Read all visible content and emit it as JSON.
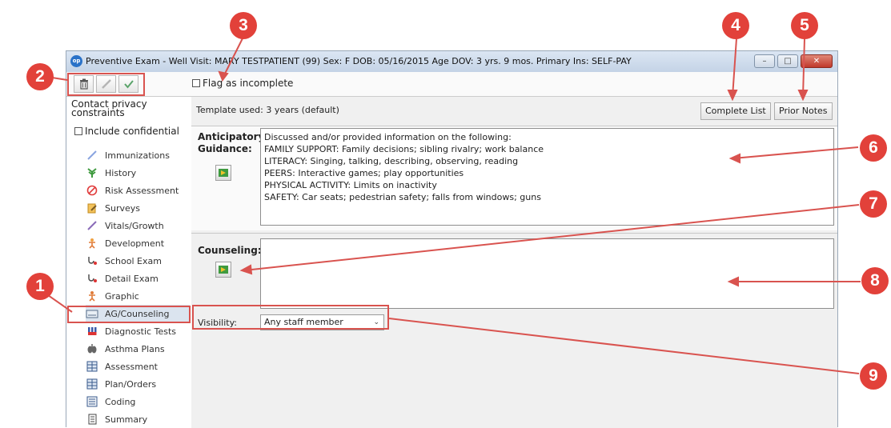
{
  "window": {
    "title": "Preventive Exam - Well Visit: MARY TESTPATIENT (99) Sex: F DOB: 05/16/2015 Age DOV: 3 yrs. 9 mos. Primary Ins: SELF-PAY",
    "icon_text": "op",
    "controls": [
      "minimize-icon",
      "maximize-icon",
      "close-icon"
    ]
  },
  "toolbar": {
    "buttons": [
      "trash-icon",
      "pencil-icon",
      "check-icon"
    ],
    "flag_label": "Flag as incomplete"
  },
  "sidebar": {
    "privacy_text": "Contact privacy constraints",
    "include_confidential": "Include confidential",
    "items": [
      {
        "label": "Immunizations",
        "icon": "syringe-icon"
      },
      {
        "label": "History",
        "icon": "tree-icon"
      },
      {
        "label": "Risk Assessment",
        "icon": "no-sign-icon"
      },
      {
        "label": "Surveys",
        "icon": "survey-icon"
      },
      {
        "label": "Vitals/Growth",
        "icon": "pen-icon"
      },
      {
        "label": "Development",
        "icon": "development-icon"
      },
      {
        "label": "School Exam",
        "icon": "stethoscope-icon"
      },
      {
        "label": "Detail Exam",
        "icon": "stethoscope-icon"
      },
      {
        "label": "Graphic",
        "icon": "figure-icon"
      },
      {
        "label": "AG/Counseling",
        "icon": "keyboard-icon"
      },
      {
        "label": "Diagnostic Tests",
        "icon": "test-tubes-icon"
      },
      {
        "label": "Asthma Plans",
        "icon": "lungs-icon"
      },
      {
        "label": "Assessment",
        "icon": "grid-icon"
      },
      {
        "label": "Plan/Orders",
        "icon": "grid-icon"
      },
      {
        "label": "Coding",
        "icon": "list-icon"
      },
      {
        "label": "Summary",
        "icon": "document-icon"
      }
    ]
  },
  "template": {
    "text": "Template used:  3 years (default)",
    "complete_list": "Complete List",
    "prior_notes": "Prior Notes"
  },
  "anticipatory": {
    "label_line1": "Anticipatory",
    "label_line2": "Guidance:",
    "lines": [
      "Discussed and/or provided information on the following:",
      "FAMILY SUPPORT: Family decisions; sibling rivalry; work balance",
      "LITERACY: Singing, talking, describing, observing, reading",
      "PEERS: Interactive games; play opportunities",
      "PHYSICAL ACTIVITY: Limits on inactivity",
      "SAFETY: Car seats; pedestrian safety; falls from windows; guns"
    ]
  },
  "counseling": {
    "label": "Counseling:",
    "value": ""
  },
  "visibility": {
    "label": "Visibility:",
    "selected": "Any staff member"
  },
  "callouts": [
    "1",
    "2",
    "3",
    "4",
    "5",
    "6",
    "7",
    "8",
    "9"
  ],
  "colors": {
    "callout": "#e2413a",
    "title_bar": "#c4d3e6",
    "active_nav": "#dbe4ef"
  }
}
